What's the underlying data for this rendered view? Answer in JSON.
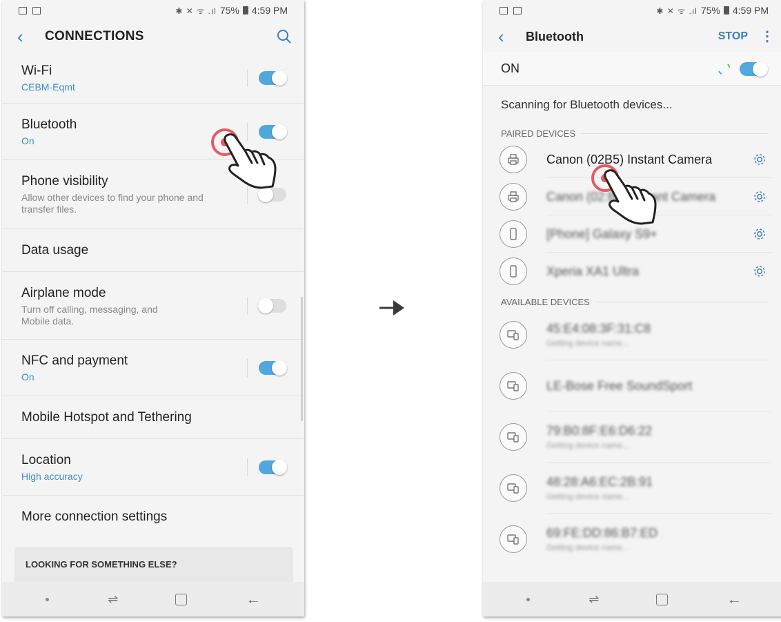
{
  "left": {
    "status": {
      "indicators": "✱ ✕ ᯤ .ıl",
      "battery_percent": "75%",
      "time": "4:59 PM"
    },
    "appbar": {
      "back_glyph": "‹",
      "title": "CONNECTIONS"
    },
    "items": [
      {
        "title": "Wi-Fi",
        "subtitle": "CEBM-Eqmt",
        "toggle": "on"
      },
      {
        "title": "Bluetooth",
        "subtitle": "On",
        "toggle": "on"
      },
      {
        "title": "Phone visibility",
        "subtitle": "Allow other devices to find your phone and transfer files.",
        "toggle": "off"
      },
      {
        "title": "Data usage"
      },
      {
        "title": "Airplane mode",
        "subtitle": "Turn off calling, messaging, and Mobile data.",
        "toggle": "off"
      },
      {
        "title": "NFC and payment",
        "subtitle": "On",
        "toggle": "on"
      },
      {
        "title": "Mobile Hotspot and Tethering"
      },
      {
        "title": "Location",
        "subtitle": "High accuracy",
        "toggle": "on"
      },
      {
        "title": "More connection settings"
      }
    ],
    "looking_card": "LOOKING FOR SOMETHING ELSE?"
  },
  "right": {
    "status": {
      "indicators": "✱ ✕ ᯤ .ıl",
      "battery_percent": "75%",
      "time": "4:59 PM"
    },
    "appbar": {
      "back_glyph": "‹",
      "title": "Bluetooth",
      "stop_label": "STOP",
      "more_glyph": "⋮"
    },
    "on_label": "ON",
    "scanning_text": "Scanning for Bluetooth devices...",
    "paired_header": "PAIRED DEVICES",
    "paired": [
      {
        "name": "Canon (02B5) Instant Camera",
        "icon": "printer-icon",
        "blurred": false
      },
      {
        "name": "Canon (02:B4) Instant Camera",
        "icon": "printer-icon",
        "blurred": true
      },
      {
        "name": "[Phone] Galaxy S9+",
        "icon": "phone-icon",
        "blurred": true
      },
      {
        "name": "Xperia XA1 Ultra",
        "icon": "phone-icon",
        "blurred": true
      }
    ],
    "available_header": "AVAILABLE DEVICES",
    "available": [
      {
        "name": "45:E4:08:3F:31:C8",
        "sub": "Getting device name..."
      },
      {
        "name": "LE-Bose Free SoundSport",
        "sub": ""
      },
      {
        "name": "79:B0:8F:E6:D6:22",
        "sub": "Getting device name..."
      },
      {
        "name": "48:28:A6:EC:2B:91",
        "sub": "Getting device name..."
      },
      {
        "name": "69:FE:DD:86:B7:ED",
        "sub": "Getting device name..."
      }
    ]
  },
  "colors": {
    "accent": "#3d7eb8",
    "toggle_on": "#50a8dc",
    "tap_ring": "#e85a63"
  },
  "nav": {
    "recent_glyph": "⌐",
    "back_glyph": "←"
  }
}
